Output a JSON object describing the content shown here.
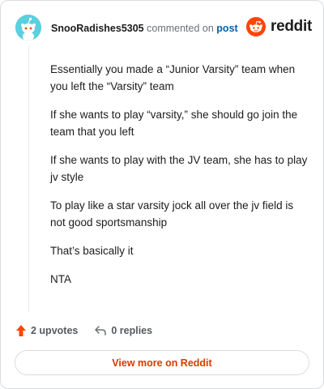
{
  "comment": {
    "username": "SnooRadishes5305",
    "action_text": "commented on",
    "post_link": "post",
    "paragraphs": [
      "Essentially you made a “Junior Varsity” team when you left the “Varsity” team",
      "If she wants to play “varsity,” she should go join the team that you left",
      "If she wants to play with the JV team, she has to play jv style",
      "To play like a star varsity jock all over the jv field is not good sportsmanship",
      "That’s basically it",
      "NTA"
    ]
  },
  "brand": {
    "name": "reddit",
    "icon": "reddit-logo-icon",
    "color": "#ff4500"
  },
  "footer": {
    "upvotes": "2 upvotes",
    "replies": "0 replies",
    "upvote_icon": "upvote-arrow-icon",
    "reply_icon": "reply-arrow-icon",
    "upvote_color": "#ff4500"
  },
  "view_more": {
    "label": "View more on Reddit",
    "color": "#d93a00"
  }
}
